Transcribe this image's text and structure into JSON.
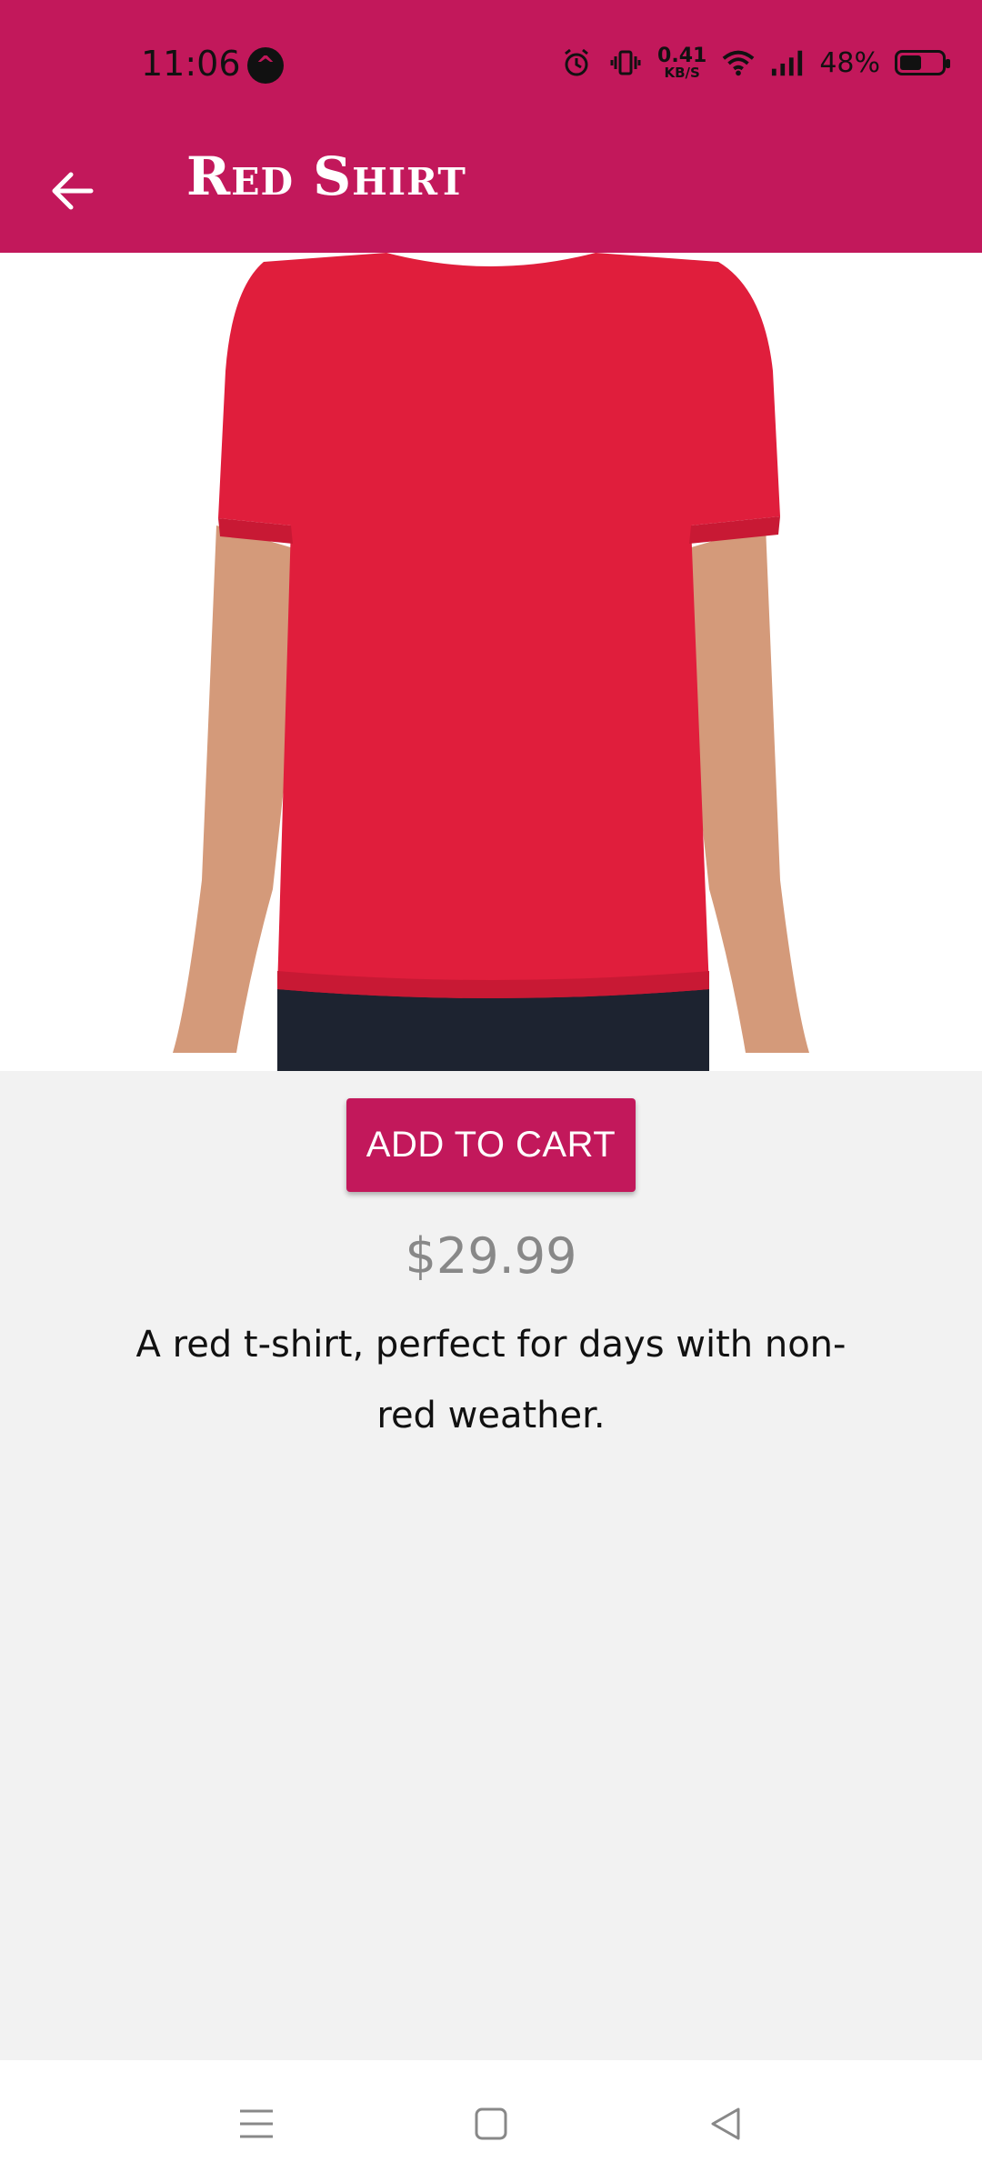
{
  "status_bar": {
    "time": "11:06",
    "app_badge": "^",
    "net_speed": "0.41",
    "net_unit": "KB/S",
    "battery": "48%"
  },
  "app_bar": {
    "title": "Red Shirt"
  },
  "product": {
    "add_to_cart_label": "ADD TO CART",
    "price": "$29.99",
    "description": "A red t-shirt, perfect for days with non-red weather."
  },
  "colors": {
    "primary": "#c2185b",
    "shirt": "#e01e3c",
    "background": "#f2f2f2"
  },
  "icons": {
    "back": "arrow-left-icon",
    "menu": "menu-icon",
    "home": "home-icon",
    "back_nav": "back-triangle-icon"
  }
}
